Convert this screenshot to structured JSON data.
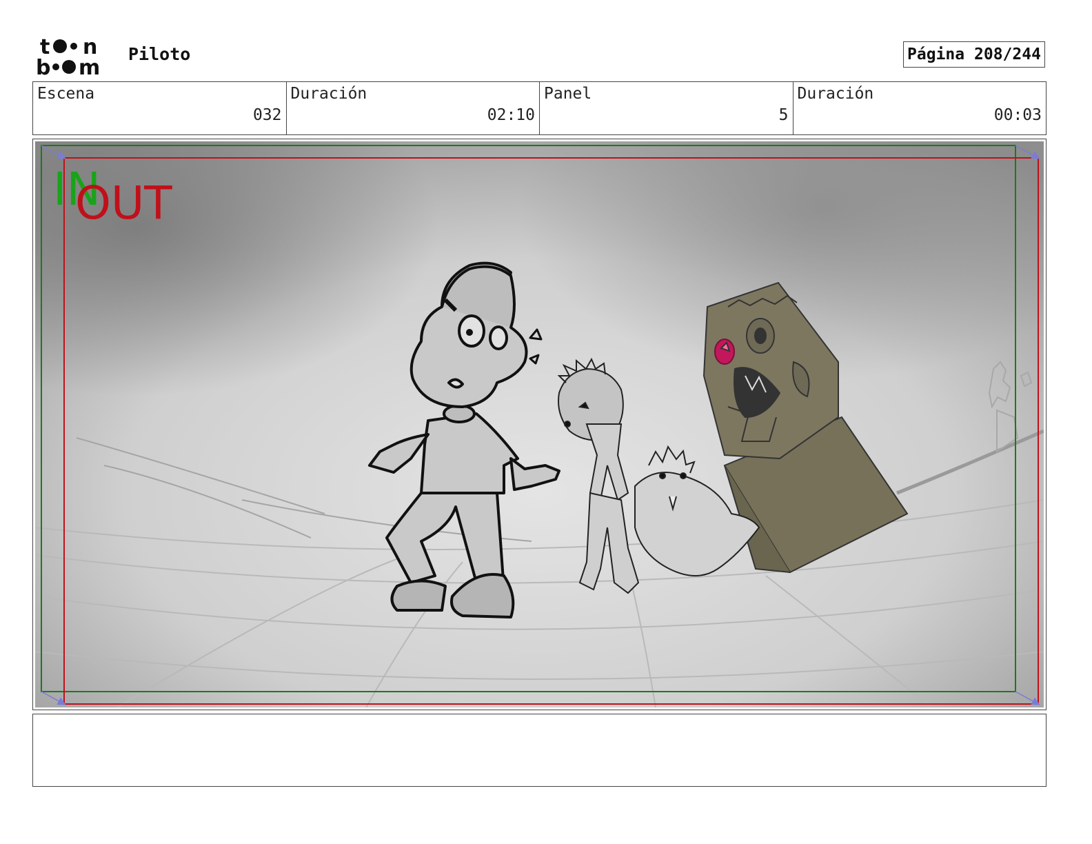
{
  "header": {
    "logo_text": "toon boom",
    "project_title": "Piloto",
    "page_label": "Página",
    "page_number": "208/244"
  },
  "info": [
    {
      "label": "Escena",
      "value": "032"
    },
    {
      "label": "Duración",
      "value": "02:10"
    },
    {
      "label": "Panel",
      "value": "5"
    },
    {
      "label": "Duración",
      "value": "00:03"
    }
  ],
  "panel": {
    "in_marker": "IN",
    "out_marker": "OUT",
    "in_color": "#1aa31a",
    "out_color": "#c0101a"
  },
  "notes": {
    "text": ""
  }
}
